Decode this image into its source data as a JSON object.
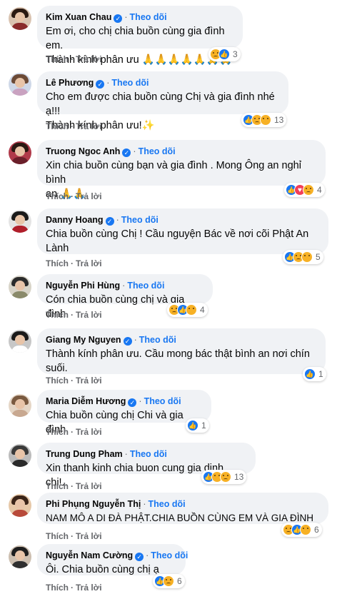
{
  "common": {
    "follow_label": "Theo dõi",
    "like_label": "Thích",
    "reply_label": "Trả lời",
    "dot": "·",
    "verified_check": "✓"
  },
  "comments": [
    {
      "name": "Kim Xuan Chau",
      "verified": true,
      "text": "Em ơi, cho chị chia buồn cùng gia đình em.\nThành kính phân ưu 🙏🙏🙏🙏🙏🙏🙏",
      "reactions": [
        "sad",
        "like"
      ],
      "count": "3"
    },
    {
      "name": "Lê Phương",
      "verified": true,
      "text": "Cho em được chia buồn cùng Chị và gia đình nhé ạ!!!\nThành kính phân ưu!✨",
      "reactions": [
        "like",
        "sad",
        "care"
      ],
      "count": "13"
    },
    {
      "name": "Truong Ngoc Anh",
      "verified": true,
      "text": "Xin chia buồn cùng bạn và gia đình . Mong Ông an nghỉ bình\nan 🙏🙏",
      "reactions": [
        "like",
        "love",
        "sad"
      ],
      "count": "4"
    },
    {
      "name": "Danny Hoang",
      "verified": true,
      "text": "Chia buồn cùng Chị ! Cầu nguyện Bác về nơi cõi Phật An\nLành",
      "reactions": [
        "like",
        "sad",
        "care"
      ],
      "count": "5"
    },
    {
      "name": "Nguyễn Phi Hùng",
      "verified": false,
      "text": "Cón chia buồn cùng chị và gia đình.",
      "reactions": [
        "sad",
        "like",
        "care"
      ],
      "count": "4"
    },
    {
      "name": "Giang My Nguyen",
      "verified": true,
      "text": "Thành kính phân ưu. Cầu mong bác thật bình an nơi chín\nsuối.",
      "reactions": [
        "like"
      ],
      "count": "1"
    },
    {
      "name": "Maria Diễm Hương",
      "verified": true,
      "text": "Chia buồn cùng chị Chi và gia đình.",
      "reactions": [
        "like"
      ],
      "count": "1"
    },
    {
      "name": "Trung Dung Pham",
      "verified": false,
      "text": "Xin thanh kinh chia buon cung gia dinh chi!..",
      "reactions": [
        "like",
        "care",
        "sad"
      ],
      "count": "13"
    },
    {
      "name": "Phi Phụng Nguyễn Thị",
      "verified": false,
      "text": "NAM MÔ A DI ĐÀ PHẬT.CHIA BUỒN CÙNG EM VÀ GIA ĐÌNH",
      "reactions": [
        "sad",
        "like",
        "haha"
      ],
      "count": "6"
    },
    {
      "name": "Nguyễn Nam Cường",
      "verified": true,
      "text": "Ôi. Chia buồn cùng chị ạ",
      "reactions": [
        "like",
        "sad"
      ],
      "count": "6"
    }
  ]
}
